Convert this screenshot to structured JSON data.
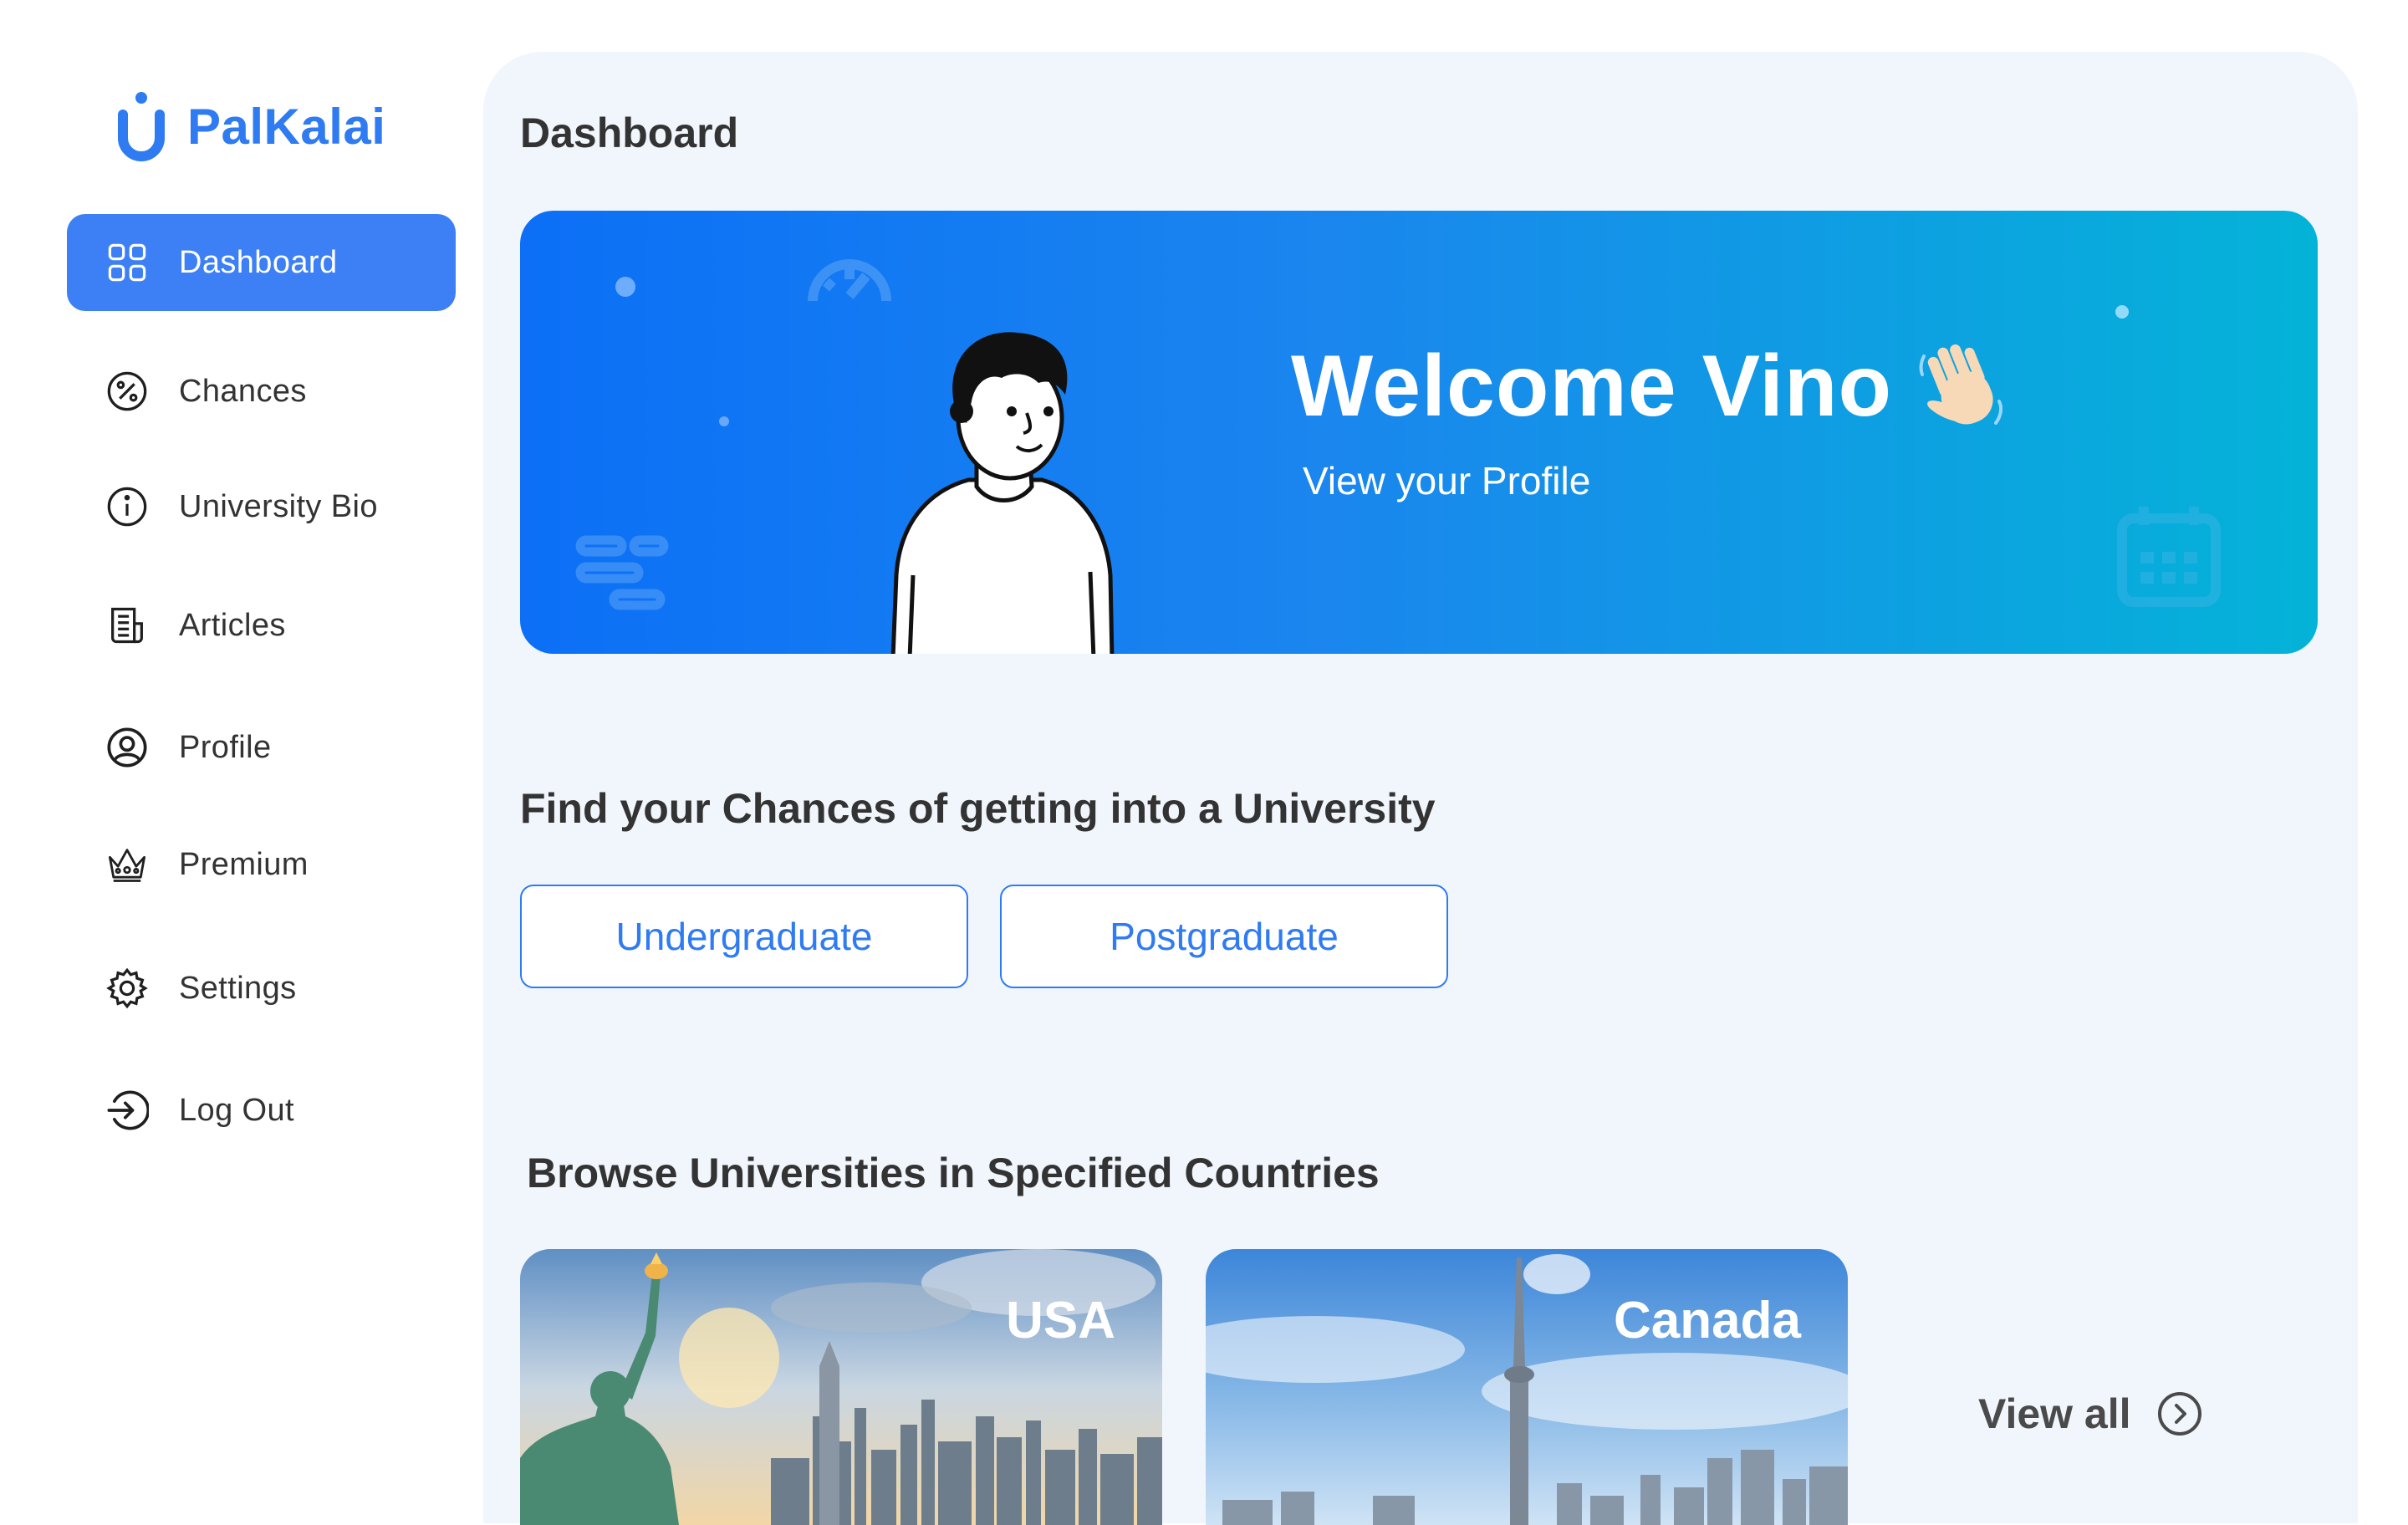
{
  "app": {
    "name": "PalKalai"
  },
  "sidebar": {
    "items": [
      {
        "label": "Dashboard",
        "icon": "grid-icon",
        "active": true
      },
      {
        "label": "Chances",
        "icon": "percent-icon",
        "active": false
      },
      {
        "label": "University Bio",
        "icon": "info-icon",
        "active": false
      },
      {
        "label": "Articles",
        "icon": "newspaper-icon",
        "active": false
      },
      {
        "label": "Profile",
        "icon": "user-circle-icon",
        "active": false
      },
      {
        "label": "Premium",
        "icon": "crown-icon",
        "active": false
      },
      {
        "label": "Settings",
        "icon": "gear-icon",
        "active": false
      },
      {
        "label": "Log Out",
        "icon": "logout-icon",
        "active": false
      }
    ]
  },
  "main": {
    "title": "Dashboard",
    "banner": {
      "greeting": "Welcome Vino",
      "emoji_icon": "waving-hand-icon",
      "link": "View your Profile"
    },
    "chances": {
      "title": "Find your Chances of getting into a University",
      "buttons": [
        "Undergraduate",
        "Postgraduate"
      ]
    },
    "countries": {
      "title": "Browse Universities in Specified Countries",
      "cards": [
        {
          "name": "USA"
        },
        {
          "name": "Canada"
        }
      ],
      "view_all": "View all"
    }
  },
  "colors": {
    "brand": "#2e7bf2",
    "active_nav": "#3d80f5",
    "banner_start": "#0c6ff6",
    "banner_end": "#04b3d8",
    "panel_bg": "#f1f6fd"
  }
}
